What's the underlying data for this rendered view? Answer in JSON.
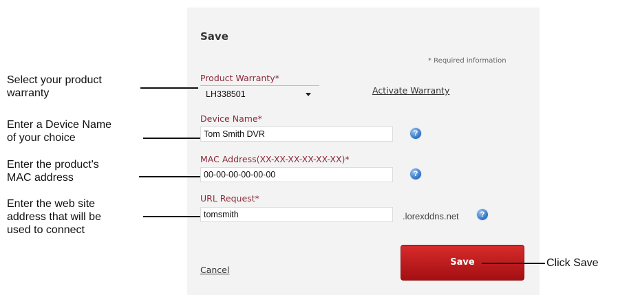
{
  "form": {
    "title": "Save",
    "required_note": "* Required information",
    "product_warranty": {
      "label": "Product Warranty*",
      "value": "LH338501"
    },
    "activate_link": "Activate Warranty",
    "device_name": {
      "label": "Device Name*",
      "value": "Tom Smith DVR"
    },
    "mac_address": {
      "label": "MAC Address(XX-XX-XX-XX-XX-XX)*",
      "value": "00-00-00-00-00-00"
    },
    "url_request": {
      "label": "URL Request*",
      "value": "tomsmith",
      "suffix": ".lorexddns.net"
    },
    "cancel_label": "Cancel",
    "save_label": "Save",
    "help_icon": "?"
  },
  "annotations": {
    "warranty": [
      "Select your product",
      "warranty"
    ],
    "device": [
      "Enter a Device Name",
      "of your choice"
    ],
    "mac": [
      "Enter the product's",
      "MAC address"
    ],
    "url": [
      "Enter the web site",
      "address that will be",
      "used to connect"
    ],
    "save": "Click Save"
  },
  "colors": {
    "label": "#8b2a3a",
    "button": "#c4161c",
    "help_icon": "#2d6fc2",
    "panel": "#f3f3f3"
  }
}
